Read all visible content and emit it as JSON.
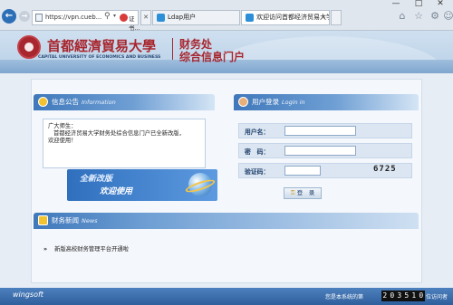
{
  "browser": {
    "address": "https://vpn.cueb...",
    "tab1_label": "证书...",
    "tab2_label": "Ldap用户",
    "tab3_label": "欢迎访问首都经济贸易大学...",
    "window_buttons": [
      "—",
      "□",
      "✕"
    ],
    "colors": {
      "back_button": "#2c6fb7",
      "tab_icon_ie": "#2d8fd8"
    }
  },
  "header": {
    "university_cn": "首都經濟貿易大學",
    "university_en": "CAPITAL UNIVERSITY OF ECONOMICS AND BUSINESS",
    "office": "财务处",
    "portal": "综合信息门户",
    "colors": {
      "brand_red": "#a8262e"
    }
  },
  "notice": {
    "title": "信息公告",
    "subtitle": "Information",
    "greeting": "广大师生：",
    "body": "首都经济贸易大学财务处综合信息门户已全新改版，",
    "closing": "欢迎使用！",
    "promo_line1": "全新改版",
    "promo_line2": "欢迎使用"
  },
  "login": {
    "title": "用户登录",
    "subtitle": "Login in",
    "username_label": "用户名：",
    "password_label": "密　码：",
    "captcha_label": "验证码：",
    "captcha_text": "6725",
    "button_label": "登　录"
  },
  "news": {
    "title": "财务新闻",
    "subtitle": "News",
    "items": [
      {
        "bullet": "»",
        "text": "新版高校财务管理平台开通啦"
      }
    ]
  },
  "footer": {
    "brand": "wingsoft",
    "visits_prefix": "您是本系统的第",
    "counter_digits": [
      "2",
      "0",
      "3",
      "5",
      "1",
      "0"
    ],
    "visits_suffix": "位访问者"
  }
}
